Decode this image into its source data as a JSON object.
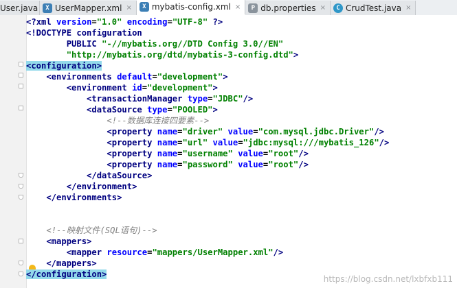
{
  "tabs": [
    {
      "label": "User.java",
      "icon": "java-class-icon",
      "active": false,
      "icon_text": "C"
    },
    {
      "label": "UserMapper.xml",
      "icon": "xml-file-icon",
      "active": false,
      "icon_text": "X"
    },
    {
      "label": "mybatis-config.xml",
      "icon": "xml-file-icon",
      "active": true,
      "icon_text": "X"
    },
    {
      "label": "db.properties",
      "icon": "properties-file-icon",
      "active": false,
      "icon_text": "P"
    },
    {
      "label": "CrudTest.java",
      "icon": "java-test-class-icon",
      "active": false,
      "icon_text": "C"
    }
  ],
  "close_glyph": "×",
  "code": {
    "l1": {
      "a": "<?",
      "b": "xml",
      "c": " version",
      "d": "=",
      "e": "\"1.0\"",
      "f": " encoding",
      "g": "=",
      "h": "\"UTF-8\"",
      "i": " ?>"
    },
    "l2": {
      "a": "<!DOCTYPE ",
      "b": "configuration"
    },
    "l3": {
      "a": "        PUBLIC ",
      "b": "\"-//mybatis.org//DTD Config 3.0//EN\""
    },
    "l4": {
      "a": "        ",
      "b": "\"http://mybatis.org/dtd/mybatis-3-config.dtd\"",
      "c": ">"
    },
    "l5": {
      "a": "<configuration>"
    },
    "l6": {
      "a": "    <environments ",
      "b": "default",
      "c": "=",
      "d": "\"development\"",
      "e": ">"
    },
    "l7": {
      "a": "        <environment ",
      "b": "id",
      "c": "=",
      "d": "\"development\"",
      "e": ">"
    },
    "l8": {
      "a": "            <transactionManager ",
      "b": "type",
      "c": "=",
      "d": "\"JDBC\"",
      "e": "/>"
    },
    "l9": {
      "a": "            <dataSource ",
      "b": "type",
      "c": "=",
      "d": "\"POOLED\"",
      "e": ">"
    },
    "l10": {
      "a": "                ",
      "b": "<!--数据库连接四要素-->"
    },
    "l11": {
      "a": "                <property ",
      "b": "name",
      "c": "=",
      "d": "\"driver\"",
      "e": " value",
      "f": "=",
      "g": "\"com.mysql.jdbc.Driver\"",
      "h": "/>"
    },
    "l12": {
      "a": "                <property ",
      "b": "name",
      "c": "=",
      "d": "\"url\"",
      "e": " value",
      "f": "=",
      "g": "\"jdbc:mysql:///mybatis_126\"",
      "h": "/>"
    },
    "l13": {
      "a": "                <property ",
      "b": "name",
      "c": "=",
      "d": "\"username\"",
      "e": " value",
      "f": "=",
      "g": "\"root\"",
      "h": "/>"
    },
    "l14": {
      "a": "                <property ",
      "b": "name",
      "c": "=",
      "d": "\"password\"",
      "e": " value",
      "f": "=",
      "g": "\"root\"",
      "h": "/>"
    },
    "l15": {
      "a": "            </dataSource>"
    },
    "l16": {
      "a": "        </environment>"
    },
    "l17": {
      "a": "    </environments>"
    },
    "l20": {
      "a": "    ",
      "b": "<!--映射文件(SQL语句)-->"
    },
    "l21": {
      "a": "    <mappers>"
    },
    "l22": {
      "a": "        <mapper ",
      "b": "resource",
      "c": "=",
      "d": "\"mappers/UserMapper.xml\"",
      "e": "/>"
    },
    "l23": {
      "a": "    </mappers>"
    },
    "l24": {
      "a": "</configuration>"
    }
  },
  "watermark": "https://blog.csdn.net/lxbfxb111",
  "colors": {
    "tag": "#000080",
    "attribute": "#0000ff",
    "value": "#008000",
    "comment": "#808080",
    "tag_match_highlight": "#93d9ea"
  }
}
